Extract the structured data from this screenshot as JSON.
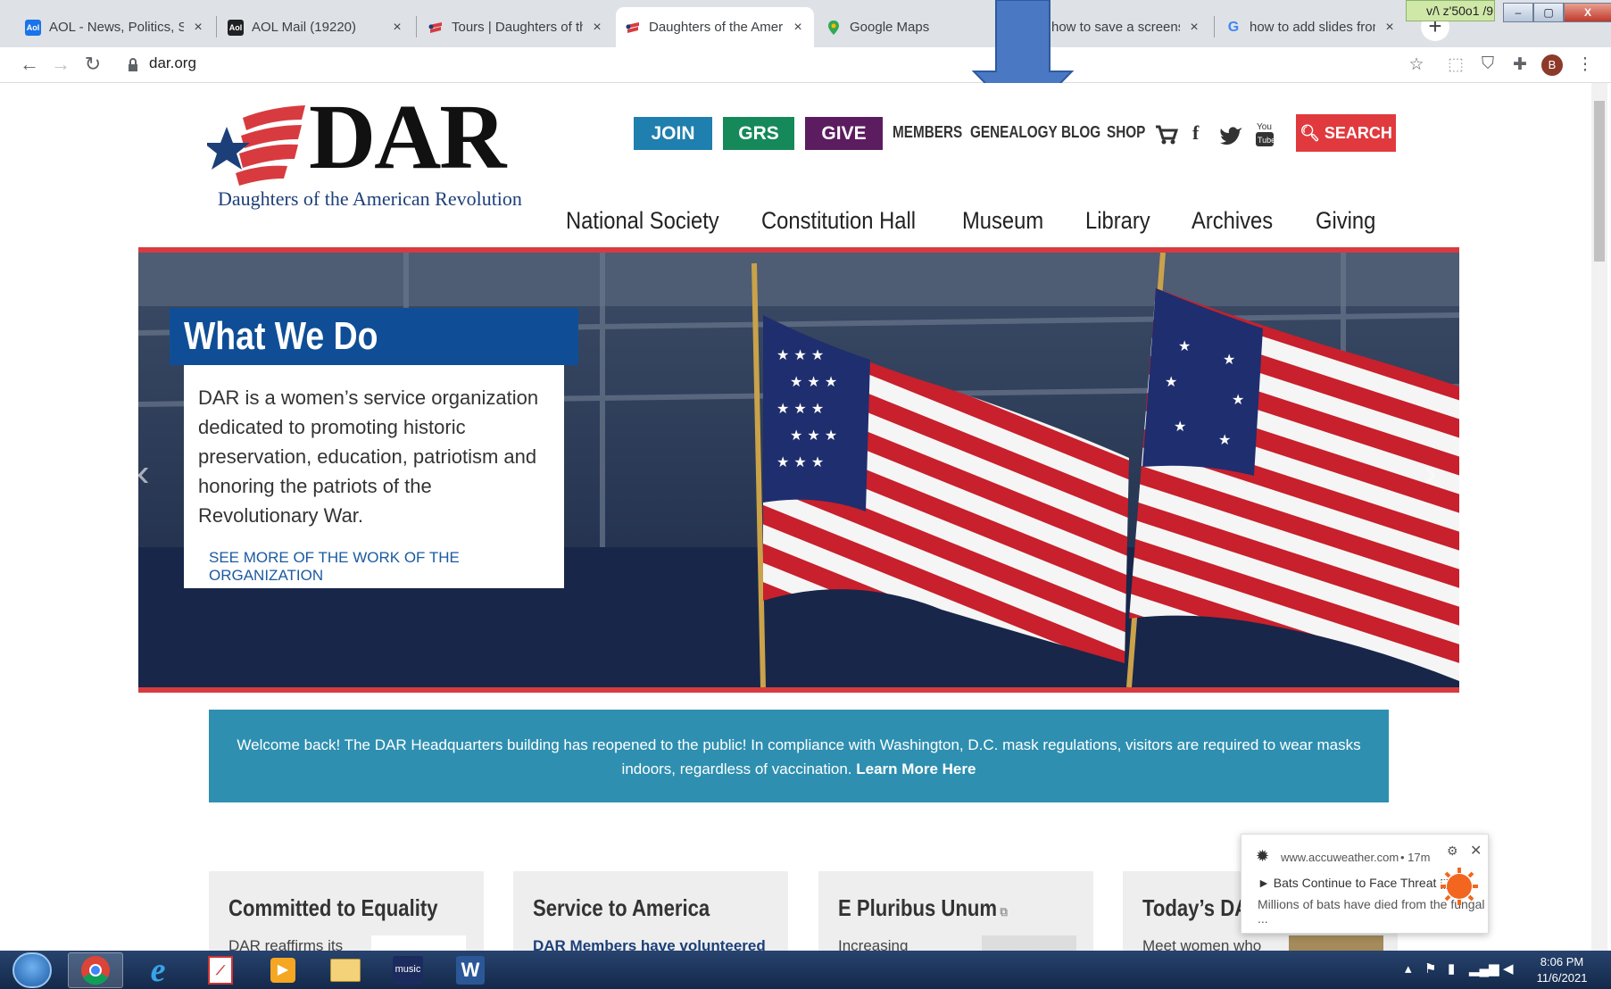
{
  "browser": {
    "tabs": [
      {
        "title": "AOL - News, Politics, Spor",
        "icon": "aol-icon",
        "color": "#1a73e8"
      },
      {
        "title": "AOL Mail (19220)",
        "icon": "aol-mail-icon",
        "color": "#202124"
      },
      {
        "title": "Tours | Daughters of the A",
        "icon": "dar-flag-icon",
        "color": "#d83b3f"
      },
      {
        "title": "Daughters of the America",
        "icon": "dar-flag-icon",
        "color": "#d83b3f",
        "active": true
      },
      {
        "title": "Google Maps",
        "icon": "maps-pin-icon",
        "color": "#34a853"
      },
      {
        "title": "how to save a screenshot",
        "icon": "google-icon",
        "color": "#4285f4"
      },
      {
        "title": "how to add slides from o",
        "icon": "google-icon",
        "color": "#4285f4"
      }
    ],
    "close_glyph": "×",
    "new_tab": "+",
    "url": "dar.org",
    "extension_badge": "v/\\ z'50o1 /9",
    "profile_initial": "B",
    "window_controls": {
      "minimize": "–",
      "maximize": "▢",
      "close": "X"
    }
  },
  "site": {
    "logo_text": "DAR",
    "logo_subtitle": "Daughters of the American Revolution",
    "top_buttons": [
      {
        "label": "JOIN",
        "color": "#1f7fae"
      },
      {
        "label": "GRS",
        "color": "#15895a"
      },
      {
        "label": "GIVE",
        "color": "#5b1d5f"
      }
    ],
    "top_links": [
      "MEMBERS",
      "GENEALOGY",
      "BLOG",
      "SHOP"
    ],
    "social_icons": [
      "cart-icon",
      "facebook-icon",
      "twitter-icon",
      "youtube-icon"
    ],
    "search_label": "SEARCH",
    "main_nav": [
      "National Society",
      "Constitution Hall",
      "Museum",
      "Library",
      "Archives",
      "Giving"
    ],
    "hero": {
      "title": "What We Do",
      "body": "DAR is a women’s service organization dedicated to promoting historic preservation, education, patriotism and honoring the patriots of the Revolutionary War.",
      "link": "SEE MORE OF THE WORK OF THE ORGANIZATION",
      "prev_glyph": "‹",
      "next_glyph": "›"
    },
    "banner": {
      "text": "Welcome back! The DAR Headquarters building has reopened to the public! In compliance with Washington, D.C. mask regulations, visitors are required to wear masks indoors, regardless of vaccination.",
      "link": "Learn More Here"
    },
    "cards": [
      {
        "title": "Committed to Equality",
        "snippet": "DAR reaffirms its"
      },
      {
        "title": "Service to America",
        "snippet": "DAR Members have volunteered"
      },
      {
        "title": "E Pluribus Unum",
        "snippet": "Increasing"
      },
      {
        "title": "Today’s DA",
        "snippet": "Meet women who"
      }
    ]
  },
  "notification": {
    "source": "www.accuweather.com",
    "age": "• 17m",
    "headline": "► Bats Continue to Face Threat ⬚",
    "body": "Millions of bats have died from the fungal ..."
  },
  "taskbar": {
    "time": "8:06 PM",
    "date": "11/6/2021",
    "apps": [
      "windows-start",
      "chrome-icon",
      "ie-icon",
      "pdf-icon",
      "media-player-icon",
      "folder-icon",
      "amazon-music-icon",
      "word-icon"
    ],
    "music_label": "music",
    "word_label": "W"
  }
}
